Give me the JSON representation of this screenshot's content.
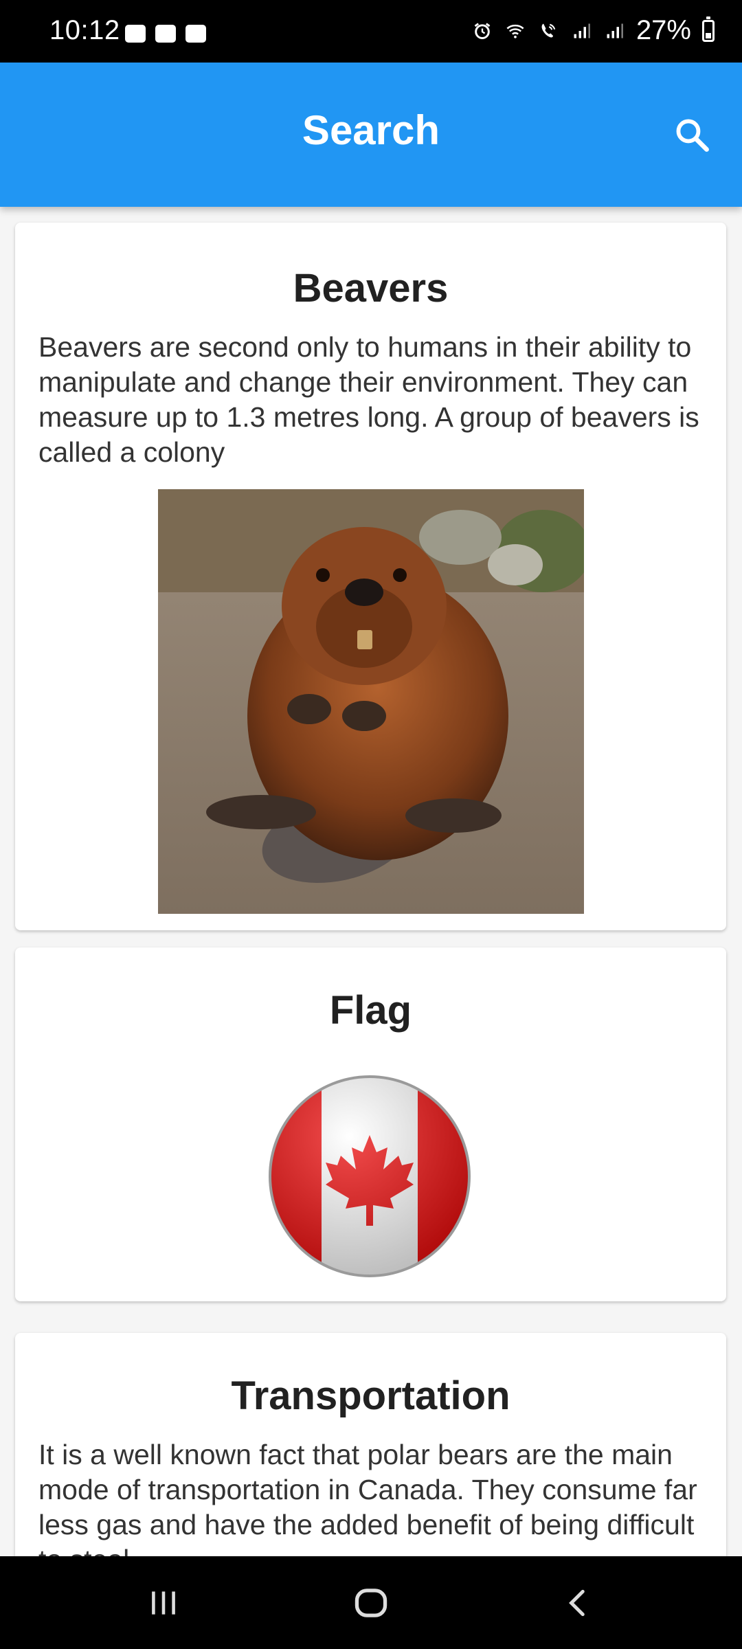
{
  "status_bar": {
    "time": "10:12",
    "battery": "27%",
    "battery_level": 0.27,
    "left_icons": [
      "paytm-icon",
      "clock-app-icon",
      "outlook-icon"
    ],
    "right_icons": [
      "alarm-icon",
      "wifi-icon",
      "wifi-call-icon",
      "signal-icon",
      "signal-icon"
    ]
  },
  "app_bar": {
    "title": "Search",
    "color": "#2196F3",
    "action_icon": "search-icon"
  },
  "cards": [
    {
      "title": "Beavers",
      "body": "Beavers are second only to humans in their ability to manipulate and change their environment. They can measure up to 1.3 metres long. A group of beavers is called a colony",
      "image": "beaver-photo"
    },
    {
      "title": "Flag",
      "image": "canada-flag-icon"
    },
    {
      "title": "Transportation",
      "body": "It is a well known fact that polar bears are the main mode of transportation in Canada. They consume far less gas and have the added benefit of being difficult to steal."
    }
  ],
  "nav_bar": {
    "buttons": [
      "recent-apps-icon",
      "home-icon",
      "back-icon"
    ]
  }
}
